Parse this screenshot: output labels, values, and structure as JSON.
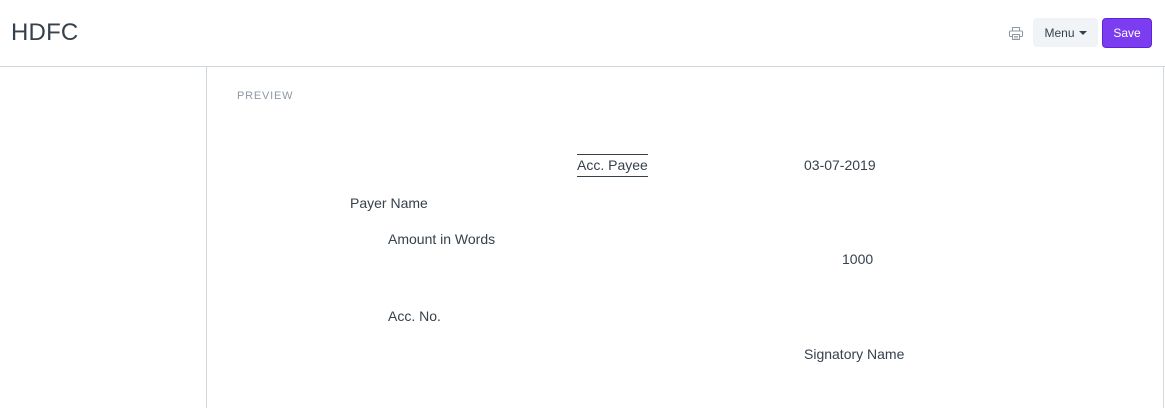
{
  "header": {
    "title": "HDFC",
    "print_icon": "printer-icon",
    "menu_label": "Menu",
    "save_label": "Save",
    "accent_color": "#7c3cf0"
  },
  "preview": {
    "section_label": "PREVIEW",
    "acc_payee": "Acc. Payee",
    "date": "03-07-2019",
    "payer_name": "Payer Name",
    "amount_in_words": "Amount in Words",
    "amount": "1000",
    "acc_no": "Acc. No.",
    "signatory_name": "Signatory Name"
  }
}
